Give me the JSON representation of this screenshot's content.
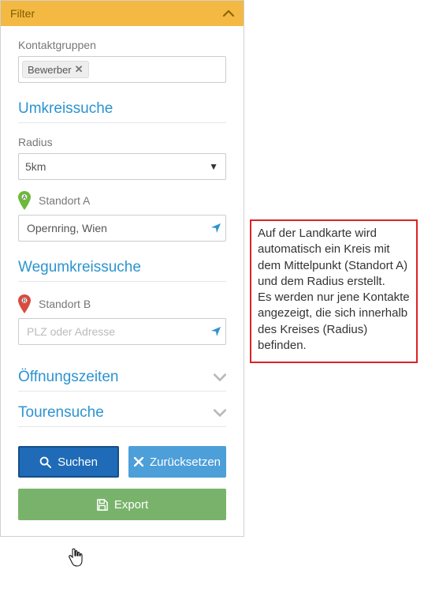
{
  "header": {
    "title": "Filter"
  },
  "contactGroups": {
    "label": "Kontaktgruppen",
    "tag": "Bewerber"
  },
  "umkreissuche": {
    "title": "Umkreissuche",
    "radiusLabel": "Radius",
    "radiusValue": "5km",
    "standortA": {
      "label": "Standort A",
      "value": "Opernring, Wien"
    }
  },
  "wegumkreissuche": {
    "title": "Wegumkreissuche",
    "standortB": {
      "label": "Standort B",
      "placeholder": "PLZ oder Adresse"
    }
  },
  "oeffnungszeiten": {
    "title": "Öffnungszeiten"
  },
  "tourensuche": {
    "title": "Tourensuche"
  },
  "buttons": {
    "search": "Suchen",
    "reset": "Zurücksetzen",
    "export": "Export"
  },
  "tooltip": {
    "line1": "Auf der Landkarte wird automatisch ein Kreis mit dem Mittelpunkt (Standort A) und dem Radius erstellt.",
    "line2": "Es werden nur jene Kontakte angezeigt, die sich innerhalb des Kreises (Radius) befinden."
  }
}
